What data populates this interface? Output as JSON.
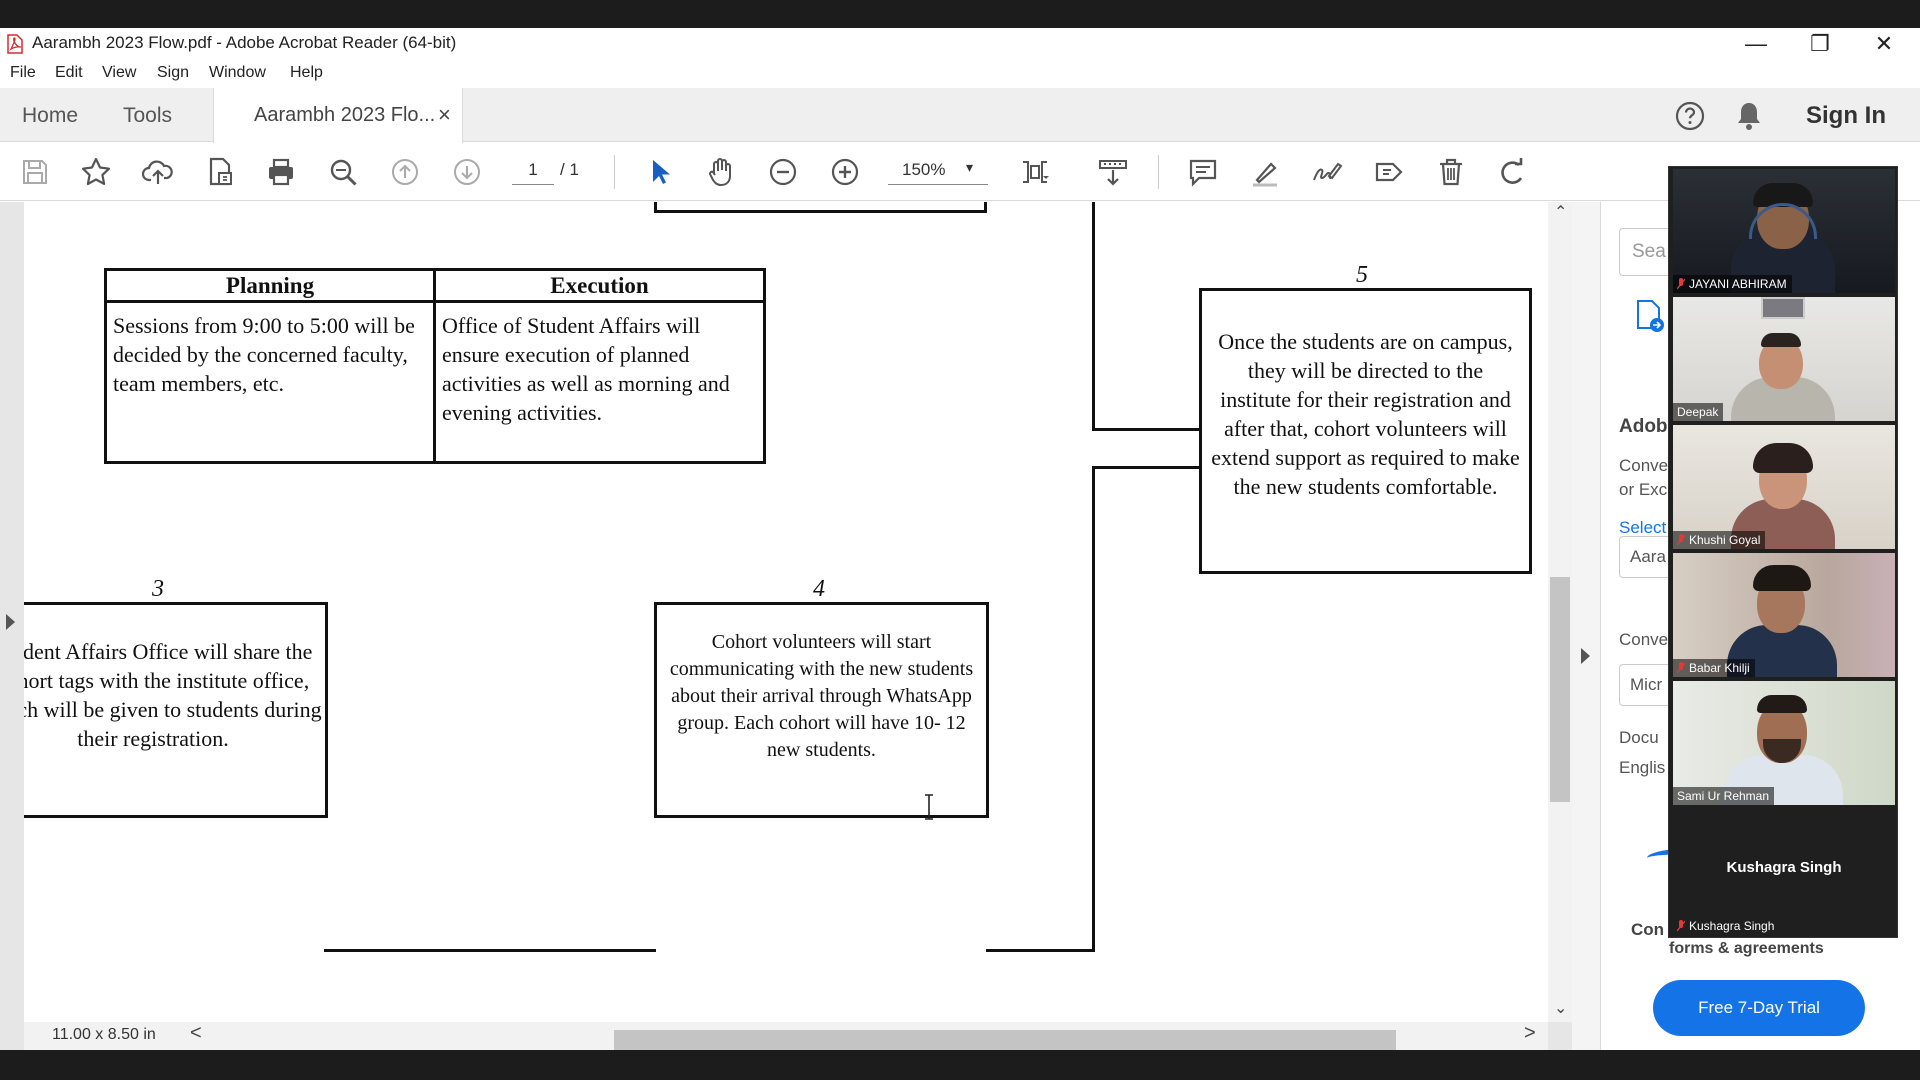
{
  "window": {
    "title": "Aarambh 2023 Flow.pdf - Adobe Acrobat Reader (64-bit)",
    "controls": {
      "minimize": "—",
      "restore": "❐",
      "close": "✕"
    }
  },
  "menu": [
    "File",
    "Edit",
    "View",
    "Sign",
    "Window",
    "Help"
  ],
  "tabs": {
    "home": "Home",
    "tools": "Tools",
    "document": "Aarambh 2023 Flo...",
    "close": "×"
  },
  "header_right": {
    "sign_in": "Sign In",
    "icons": [
      "help-icon",
      "bell-icon"
    ]
  },
  "toolbar": {
    "page_current": "1",
    "page_total": "/ 1",
    "zoom": "150%",
    "zoom_caret": "▾",
    "icons": [
      "save-icon",
      "star-icon",
      "upload-icon",
      "file-icon",
      "print-icon",
      "search-zoom-icon",
      "page-up-icon",
      "page-down-icon",
      "select-arrow-icon",
      "hand-icon",
      "zoom-out-icon",
      "zoom-in-icon",
      "fit-page-icon",
      "scroll-mode-icon",
      "comment-icon",
      "highlight-icon",
      "sign-icon",
      "tag-icon",
      "delete-icon",
      "rotate-icon"
    ]
  },
  "document": {
    "table": {
      "headers": [
        "Planning",
        "Execution"
      ],
      "cells": [
        "Sessions from 9:00 to 5:00 will be decided by the concerned faculty, team members, etc.",
        "Office of Student Affairs will ensure execution of planned activities as well as morning and evening activities."
      ]
    },
    "step3": {
      "number": "3",
      "text": "Student Affairs Office will share the cohort tags with the institute office, which will be given to students during their registration."
    },
    "step4": {
      "number": "4",
      "text": "Cohort volunteers will start communicating with the new students about their arrival through WhatsApp group. Each cohort will have 10- 12 new students."
    },
    "step5": {
      "number": "5",
      "text": "Once the students are on campus, they will be directed to the institute for their registration and after that, cohort volunteers will extend support as required to make the new students comfortable."
    },
    "page_size": "11.00 x 8.50 in",
    "scroll": {
      "left": "<",
      "right": ">",
      "up": "⌃",
      "down": "⌄"
    }
  },
  "right_pane": {
    "search_placeholder": "Sea",
    "heading": "Adob",
    "line1": "Conve",
    "line2": "or Exc",
    "select_link": "Select",
    "select_value": "Aara",
    "convert_label": "Conve",
    "convert_value": "Micr",
    "doc_label": "Docu",
    "lang_value": "Englis",
    "promo_label": "Con",
    "promo_sub": "forms & agreements",
    "trial_button": "Free 7-Day Trial"
  },
  "video_call": {
    "participants": [
      "JAYANI ABHIRAM",
      "Deepak",
      "Khushi Goyal",
      "Babar Khilji",
      "Sami Ur Rehman",
      "Kushagra Singh"
    ],
    "name_only_tile": "Kushagra Singh"
  },
  "colors": {
    "accent": "#1473e6",
    "select_link": "#1473e6",
    "mic_muted": "#e03a3a"
  }
}
